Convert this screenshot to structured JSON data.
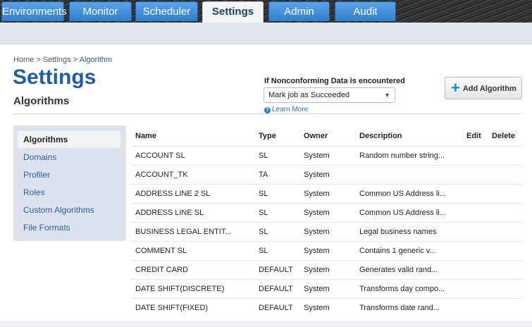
{
  "tabs": [
    {
      "label": "Environments",
      "active": false
    },
    {
      "label": "Monitor",
      "active": false
    },
    {
      "label": "Scheduler",
      "active": false
    },
    {
      "label": "Settings",
      "active": true
    },
    {
      "label": "Admin",
      "active": false
    },
    {
      "label": "Audit",
      "active": false
    }
  ],
  "breadcrumb": {
    "home": "Home",
    "sep1": ">",
    "settings": "Settings",
    "sep2": ">",
    "current": "Algorithm"
  },
  "page_title": "Settings",
  "section_title": "Algorithms",
  "nonconforming": {
    "label": "If Nonconforming Data is encountered",
    "selected": "Mark job as Succeeded",
    "learn_more": "Learn More"
  },
  "add_button": {
    "label": "Add Algorithm"
  },
  "sidebar": {
    "items": [
      {
        "label": "Algorithms",
        "active": true
      },
      {
        "label": "Domains",
        "active": false
      },
      {
        "label": "Profiler",
        "active": false
      },
      {
        "label": "Roles",
        "active": false
      },
      {
        "label": "Custom Algorithms",
        "active": false
      },
      {
        "label": "File Formats",
        "active": false
      }
    ]
  },
  "table": {
    "headers": {
      "name": "Name",
      "type": "Type",
      "owner": "Owner",
      "description": "Description",
      "edit": "Edit",
      "delete": "Delete"
    },
    "rows": [
      {
        "name": "ACCOUNT SL",
        "type": "SL",
        "owner": "System",
        "description": "Random number string..."
      },
      {
        "name": "ACCOUNT_TK",
        "type": "TA",
        "owner": "System",
        "description": ""
      },
      {
        "name": "ADDRESS LINE 2 SL",
        "type": "SL",
        "owner": "System",
        "description": "Common US Address li..."
      },
      {
        "name": "ADDRESS LINE SL",
        "type": "SL",
        "owner": "System",
        "description": "Common US Address li..."
      },
      {
        "name": "BUSINESS LEGAL ENTIT...",
        "type": "SL",
        "owner": "System",
        "description": "Legal business names"
      },
      {
        "name": "COMMENT SL",
        "type": "SL",
        "owner": "System",
        "description": "Contains 1 generic v..."
      },
      {
        "name": "CREDIT CARD",
        "type": "DEFAULT",
        "owner": "System",
        "description": "Generates valid rand..."
      },
      {
        "name": "DATE SHIFT(DISCRETE)",
        "type": "DEFAULT",
        "owner": "System",
        "description": "Transforms day compo..."
      },
      {
        "name": "DATE SHIFT(FIXED)",
        "type": "DEFAULT",
        "owner": "System",
        "description": "Transforms date rand..."
      }
    ]
  }
}
